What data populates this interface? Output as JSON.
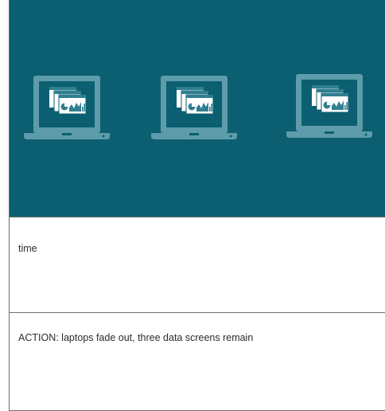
{
  "colors": {
    "panel_bg": "#0b5f70",
    "laptop": "#5e9cab",
    "screen_fill": "#0b5f70",
    "window": "#ffffff",
    "window_bar": "#2f7f90"
  },
  "illustration": {
    "laptops": [
      {
        "name": "laptop-left",
        "icon": "laptop-icon",
        "screen_icon": "data-screens-icon"
      },
      {
        "name": "laptop-middle",
        "icon": "laptop-icon",
        "screen_icon": "data-screens-icon"
      },
      {
        "name": "laptop-right",
        "icon": "laptop-icon",
        "screen_icon": "data-screens-icon"
      }
    ]
  },
  "rows": {
    "time_label": "time",
    "action_text": "ACTION: laptops fade out, three data screens remain"
  }
}
